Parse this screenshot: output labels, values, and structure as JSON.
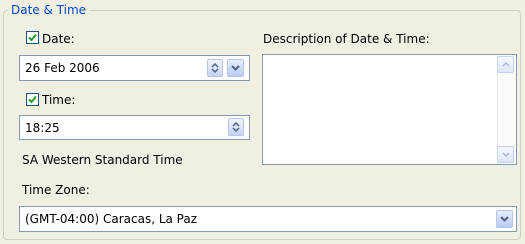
{
  "group": {
    "title": "Date & Time"
  },
  "date": {
    "label": "Date:",
    "checked": true,
    "value": "26 Feb 2006"
  },
  "time": {
    "label": "Time:",
    "checked": true,
    "value": "18:25"
  },
  "zone_name": "SA Western Standard Time",
  "description": {
    "label": "Description of Date & Time:",
    "value": ""
  },
  "time_zone": {
    "label": "Time Zone:",
    "value": "(GMT-04:00) Caracas, La Paz"
  },
  "icons": {
    "checkbox": "check-icon",
    "spin": "up-down-arrows-icon",
    "dropdown": "chevron-down-icon",
    "scroll_up": "scroll-up-arrow-icon",
    "scroll_down": "scroll-down-arrow-icon"
  },
  "colors": {
    "background": "#f1efe2",
    "group_title": "#0046d5",
    "field_border": "#7f9db9",
    "check": "#21a121"
  }
}
